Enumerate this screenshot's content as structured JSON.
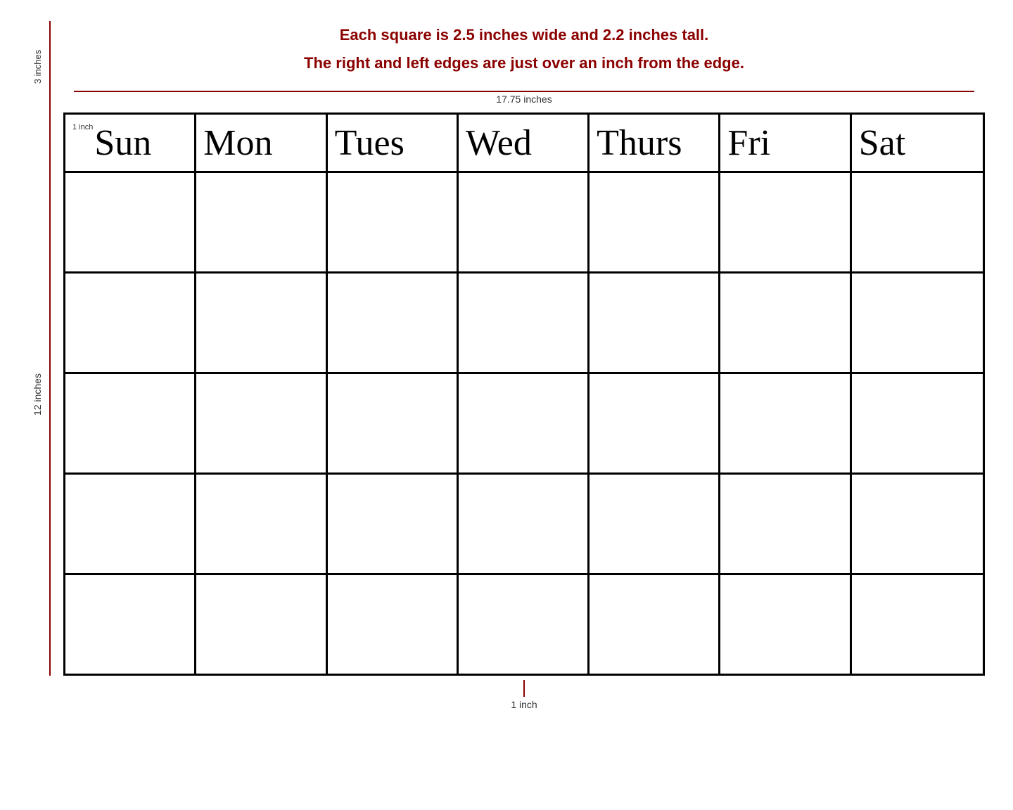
{
  "instructions": {
    "line1": "Each square is 2.5 inches wide and 2.2 inches tall.",
    "line2": "The right and left edges are just over an inch from the edge."
  },
  "rulers": {
    "top_vertical": "3 inches",
    "horizontal": "17.75 inches",
    "left_vertical": "12 inches",
    "bottom": "1 inch"
  },
  "calendar": {
    "inch_label": "1 inch",
    "days": [
      "Sun",
      "Mon",
      "Tues",
      "Wed",
      "Thurs",
      "Fri",
      "Sat"
    ],
    "rows": 5
  }
}
